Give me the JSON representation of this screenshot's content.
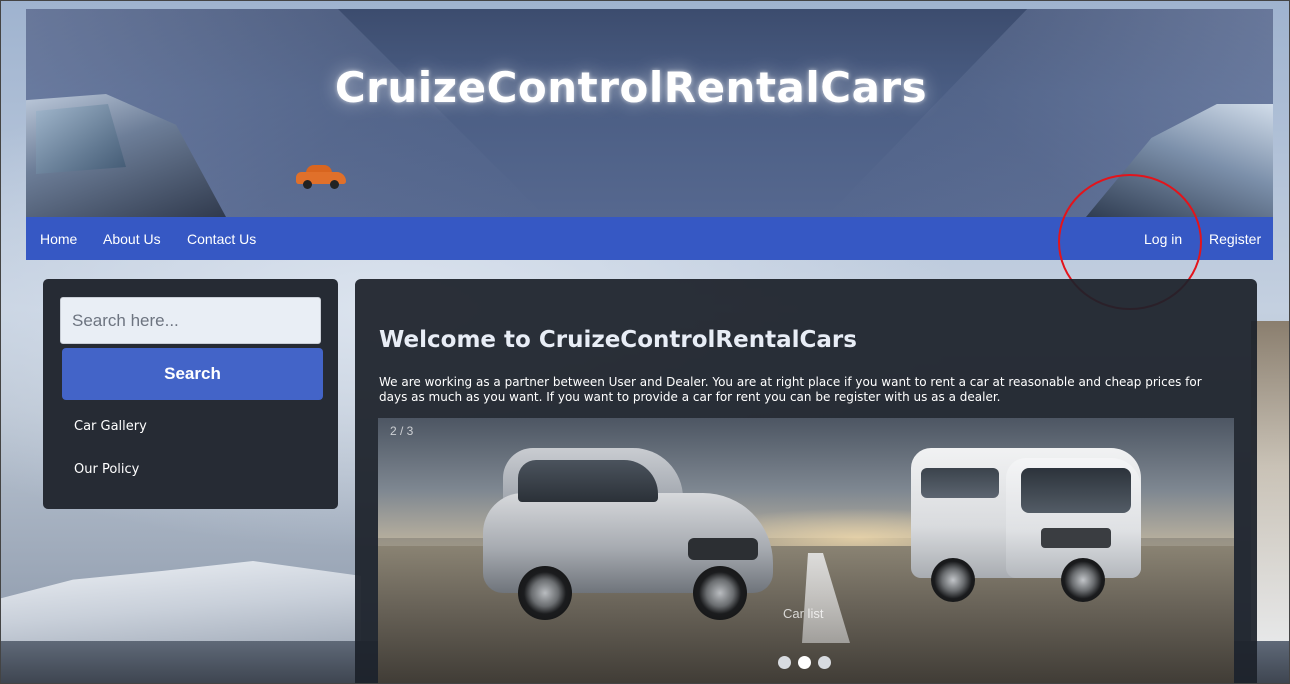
{
  "header": {
    "site_title": "CruizeControlRentalCars"
  },
  "nav": {
    "left": [
      {
        "label": "Home"
      },
      {
        "label": "About Us"
      },
      {
        "label": "Contact Us"
      }
    ],
    "right": [
      {
        "label": "Log in"
      },
      {
        "label": "Register"
      }
    ]
  },
  "sidebar": {
    "search_placeholder": "Search here...",
    "search_button": "Search",
    "links": [
      {
        "label": "Car Gallery"
      },
      {
        "label": "Our Policy"
      }
    ]
  },
  "main": {
    "welcome_title": "Welcome to CruizeControlRentalCars",
    "welcome_text": "We are working as a partner between User and Dealer. You are at right place if you want to rent a car at reasonable and cheap prices for days as much as you want. If you want to provide a car for rent you can be register with us as a dealer.",
    "carousel": {
      "counter": "2 / 3",
      "caption": "Car list",
      "slides": 3
    }
  },
  "colors": {
    "navbar": "#3658c4",
    "search_button": "#4364c8",
    "panel": "#262b34",
    "annotation": "#e3141b"
  }
}
